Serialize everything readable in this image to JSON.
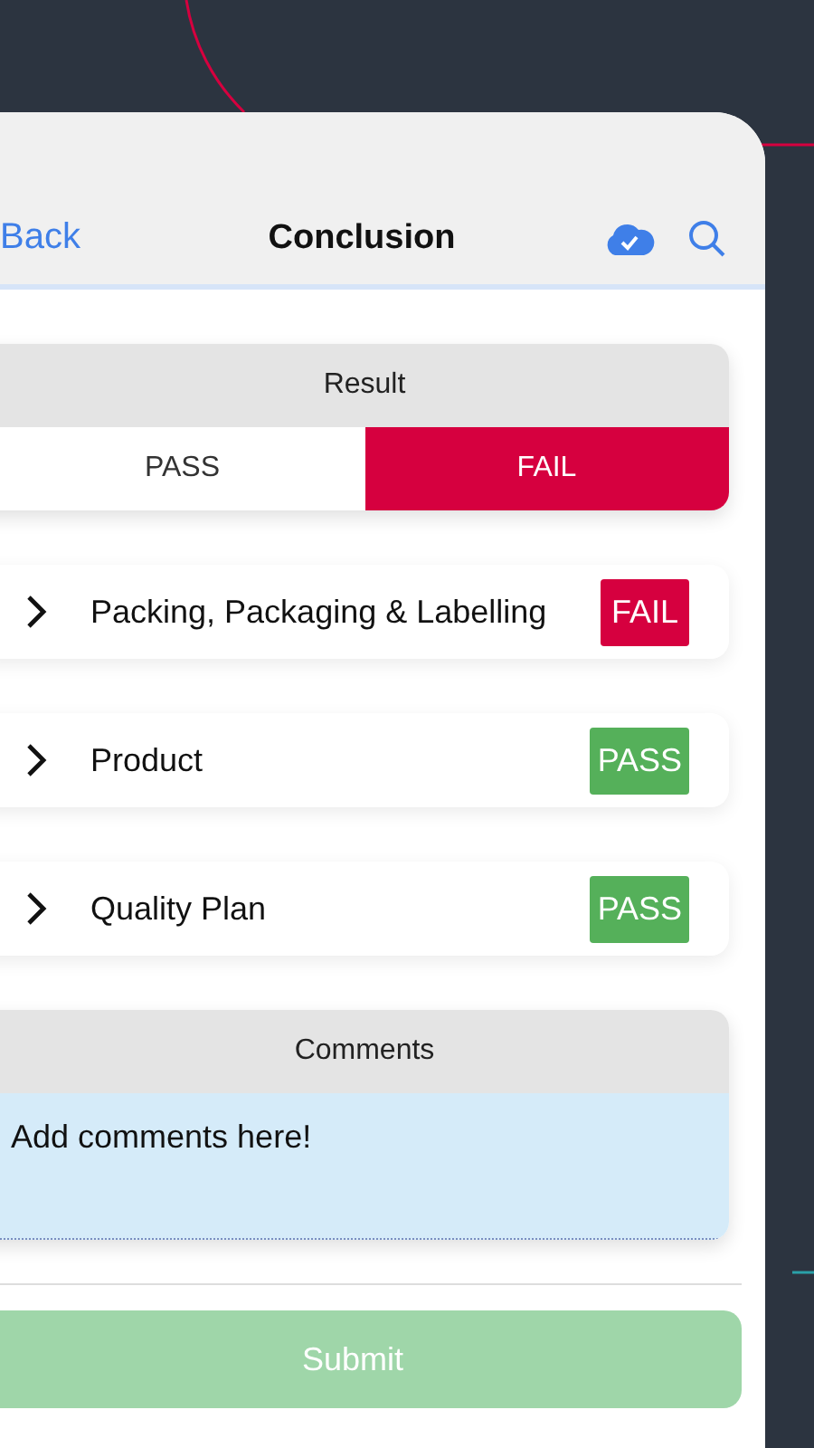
{
  "nav_bar": {
    "back": "Back",
    "title": "Conclusion"
  },
  "result": {
    "title": "Result",
    "options": [
      {
        "label": "PASS",
        "selected": false
      },
      {
        "label": "FAIL",
        "selected": true
      }
    ]
  },
  "sections": [
    {
      "label": "Packing, Packaging & Labelling",
      "badge": "FAIL",
      "kind": "fail"
    },
    {
      "label": "Product",
      "badge": "PASS",
      "kind": "pass"
    },
    {
      "label": "Quality Plan",
      "badge": "PASS",
      "kind": "pass"
    }
  ],
  "comments": {
    "title": "Comments",
    "placeholder": "Add comments here!"
  },
  "submit": {
    "label": "Submit",
    "disabled": true
  }
}
